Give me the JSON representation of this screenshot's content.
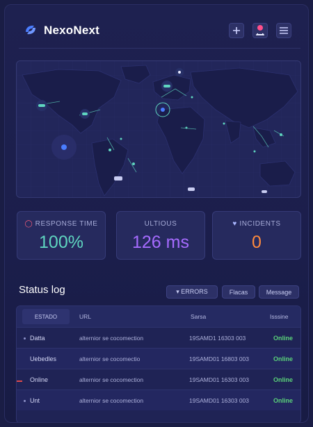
{
  "app": {
    "brand": "NexoNext"
  },
  "colors": {
    "accent_blue": "#4a7dff",
    "green": "#5ad17a",
    "teal": "#5fd6c0",
    "purple": "#a66bff",
    "orange": "#ff8a3d",
    "alert_pink": "#ff4f8b"
  },
  "header": {
    "icons": [
      "logo-icon",
      "add-icon",
      "user-alert-icon",
      "menu-icon"
    ]
  },
  "metrics": [
    {
      "label": "RESPONSE TIME",
      "value": "100%",
      "icon": "shield-icon"
    },
    {
      "label": "ULTIOUS",
      "value": "126 ms",
      "icon": ""
    },
    {
      "label": "INCIDENTS",
      "value": "0",
      "icon": "heart-icon"
    }
  ],
  "status_log": {
    "title": "Status log",
    "chips": [
      "▾ ERRORS",
      "Flacas",
      "Message"
    ],
    "columns": [
      "ESTADO",
      "URL",
      "Sarsa",
      "Isssine"
    ],
    "rows": [
      {
        "estado": "Datta",
        "url": "alternior se cocomection",
        "date": "19SAMD1 16303 003",
        "status": "Online"
      },
      {
        "estado": "Uebedles",
        "url": "alternior se cocomectio",
        "date": "19SAMD01 16803 003",
        "status": "Online"
      },
      {
        "estado": "Online",
        "url": "alternior se cocomection",
        "date": "19SAMD01 16303 003",
        "status": "Online"
      },
      {
        "estado": "Unt",
        "url": "alternior se cocomection",
        "date": "19SAMD01 16303 003",
        "status": "Online"
      }
    ]
  }
}
